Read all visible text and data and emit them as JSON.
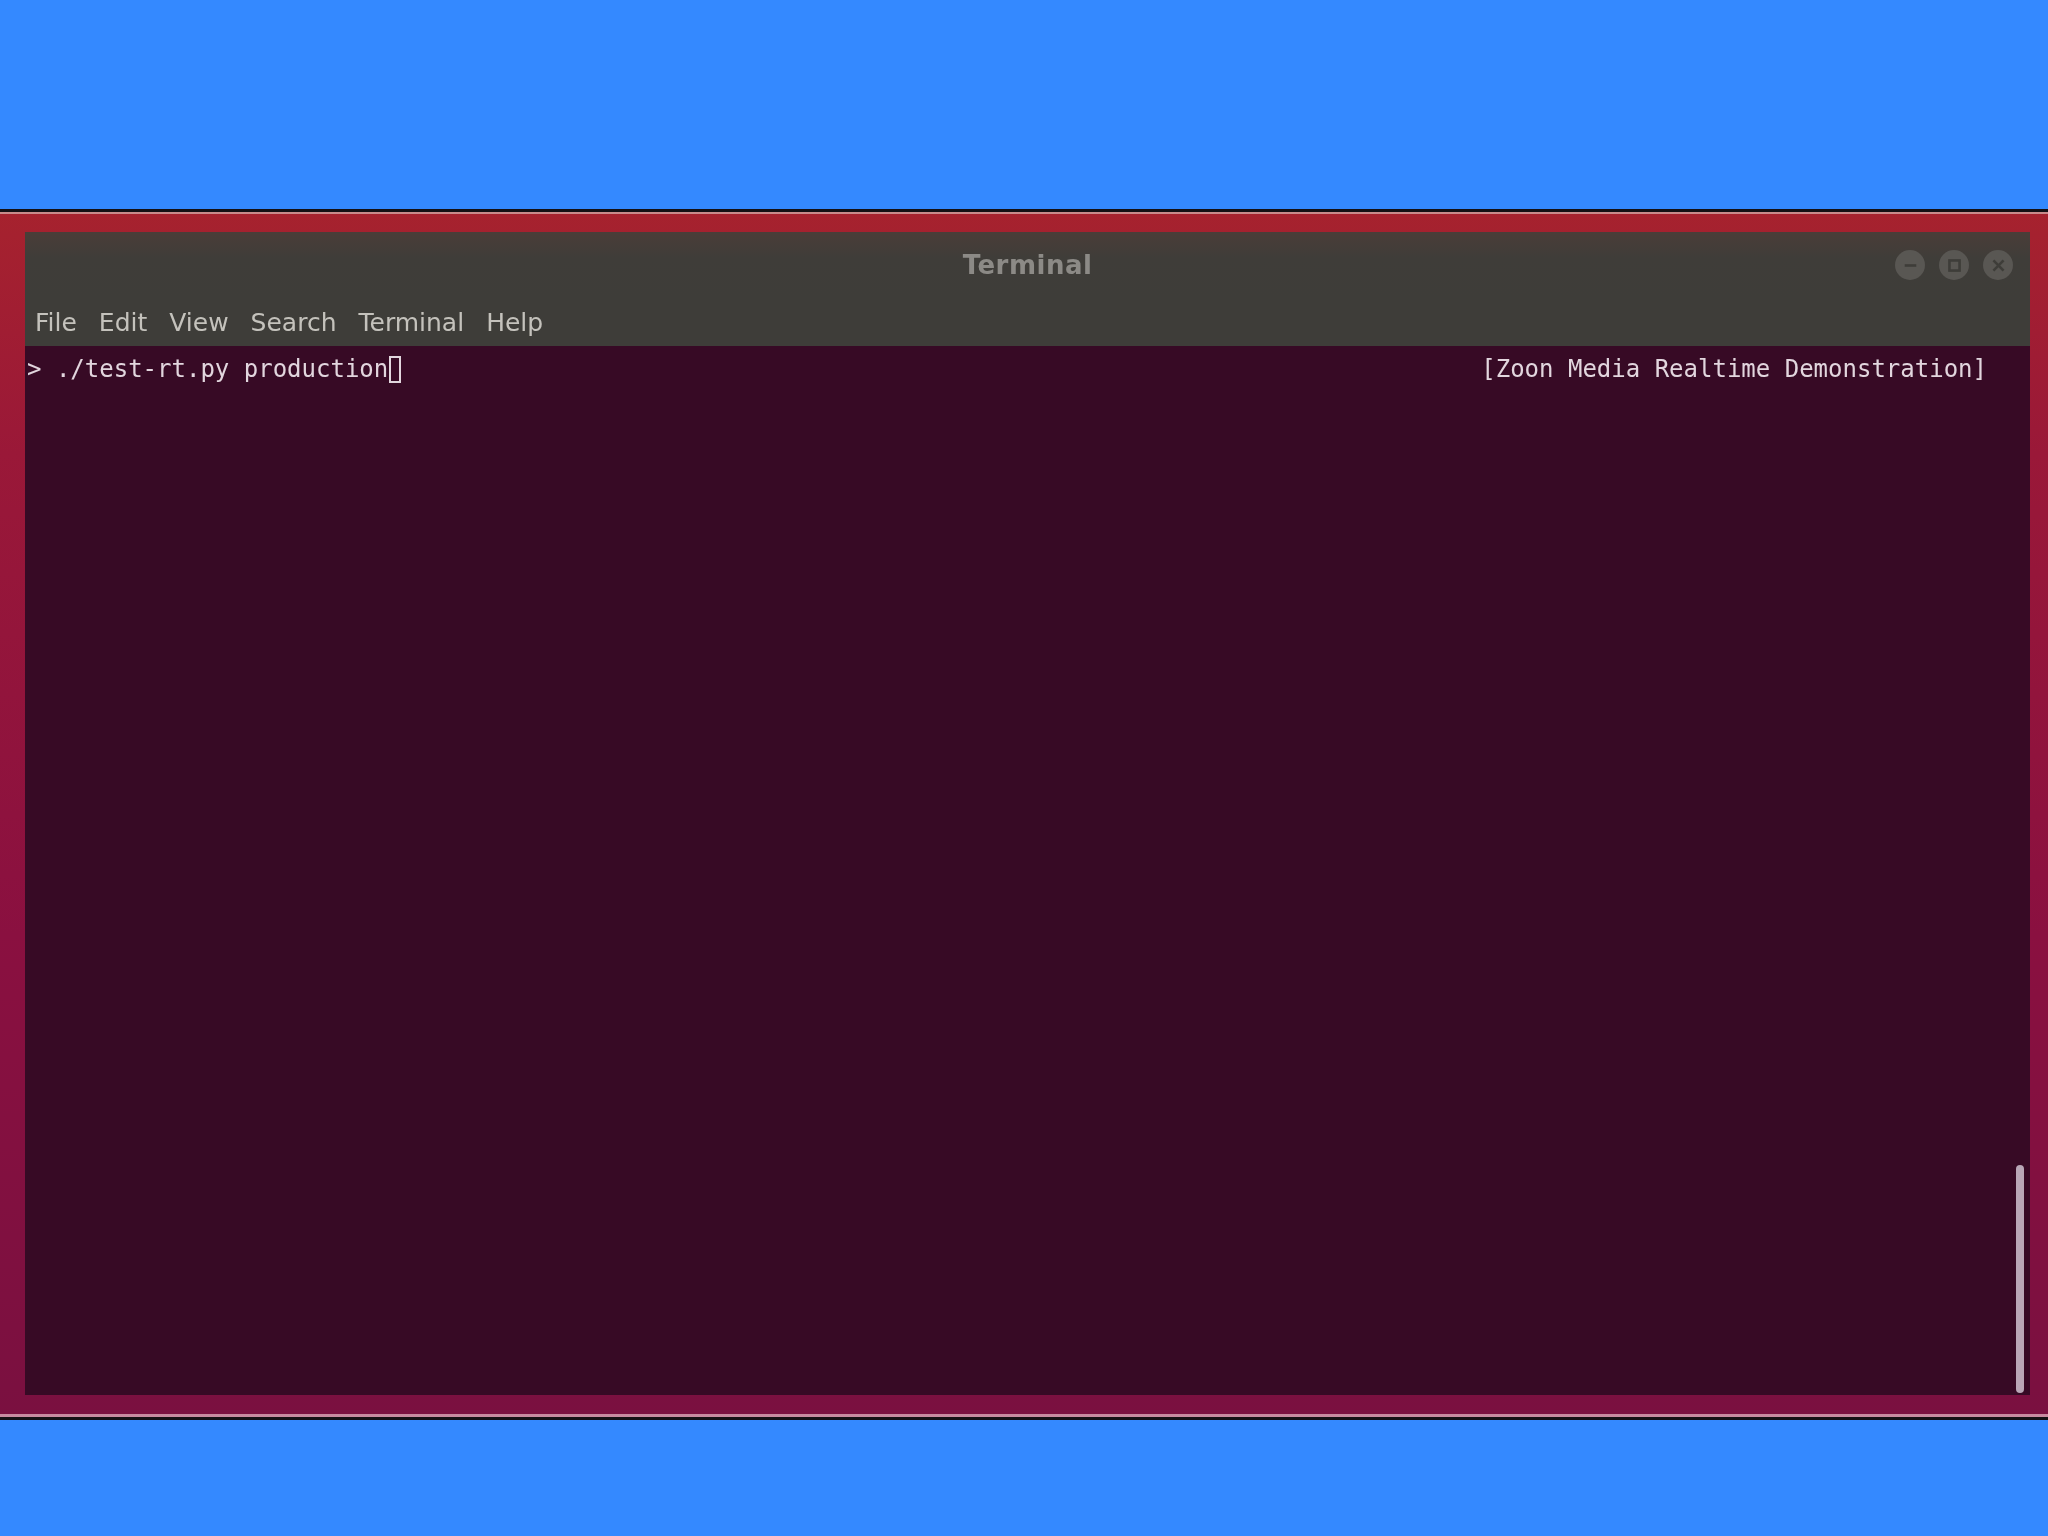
{
  "window": {
    "title": "Terminal",
    "active": false
  },
  "menu": [
    "File",
    "Edit",
    "View",
    "Search",
    "Terminal",
    "Help"
  ],
  "terminal": {
    "lines": [
      {
        "text": "> ./test-rt.py production",
        "cursor": true
      }
    ],
    "banner": "[Zoon Media Realtime Demonstration]"
  }
}
